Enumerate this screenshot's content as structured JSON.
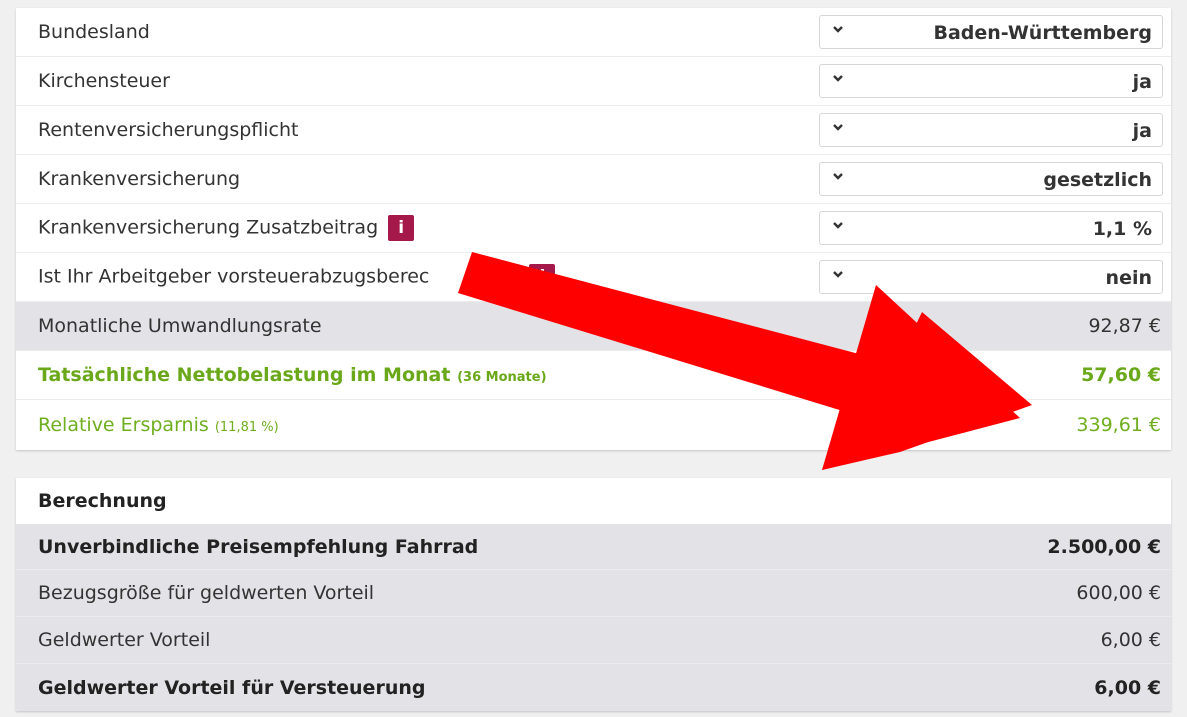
{
  "settings": {
    "rows": [
      {
        "label": "Bundesland",
        "value": "Baden-Württemberg"
      },
      {
        "label": "Kirchensteuer",
        "value": "ja"
      },
      {
        "label": "Rentenversicherungspflicht",
        "value": "ja"
      },
      {
        "label": "Krankenversicherung",
        "value": "gesetzlich"
      },
      {
        "label": "Krankenversicherung Zusatzbeitrag",
        "value": "1,1 %",
        "info": "i"
      },
      {
        "label": "Ist Ihr Arbeitgeber vorsteuerabzugsberec",
        "value": "nein",
        "info": "i"
      }
    ]
  },
  "results": {
    "monthly_rate": {
      "label": "Monatliche Umwandlungsrate",
      "value": "92,87 €"
    },
    "net_burden": {
      "label": "Tatsächliche Nettobelastung im Monat",
      "note": "(36 Monate)",
      "value": "57,60 €"
    },
    "savings": {
      "label": "Relative Ersparnis",
      "note": "(11,81 %)",
      "value": "339,61 €"
    }
  },
  "calculation": {
    "header": "Berechnung",
    "rows": [
      {
        "label": "Unverbindliche Preisempfehlung Fahrrad",
        "value": "2.500,00 €"
      },
      {
        "label": "Bezugsgröße für geldwerten Vorteil",
        "value": "600,00 €"
      },
      {
        "label": "Geldwerter Vorteil",
        "value": "6,00 €"
      },
      {
        "label": "Geldwerter Vorteil für Versteuerung",
        "value": "6,00 €"
      }
    ]
  },
  "colors": {
    "accent_green": "#6fae1f",
    "info_badge": "#a4194a",
    "arrow_red": "#ff0000"
  },
  "icons": {
    "select_chevron": "chevron-down-icon",
    "overlay_arrow": "red-arrow-icon"
  }
}
